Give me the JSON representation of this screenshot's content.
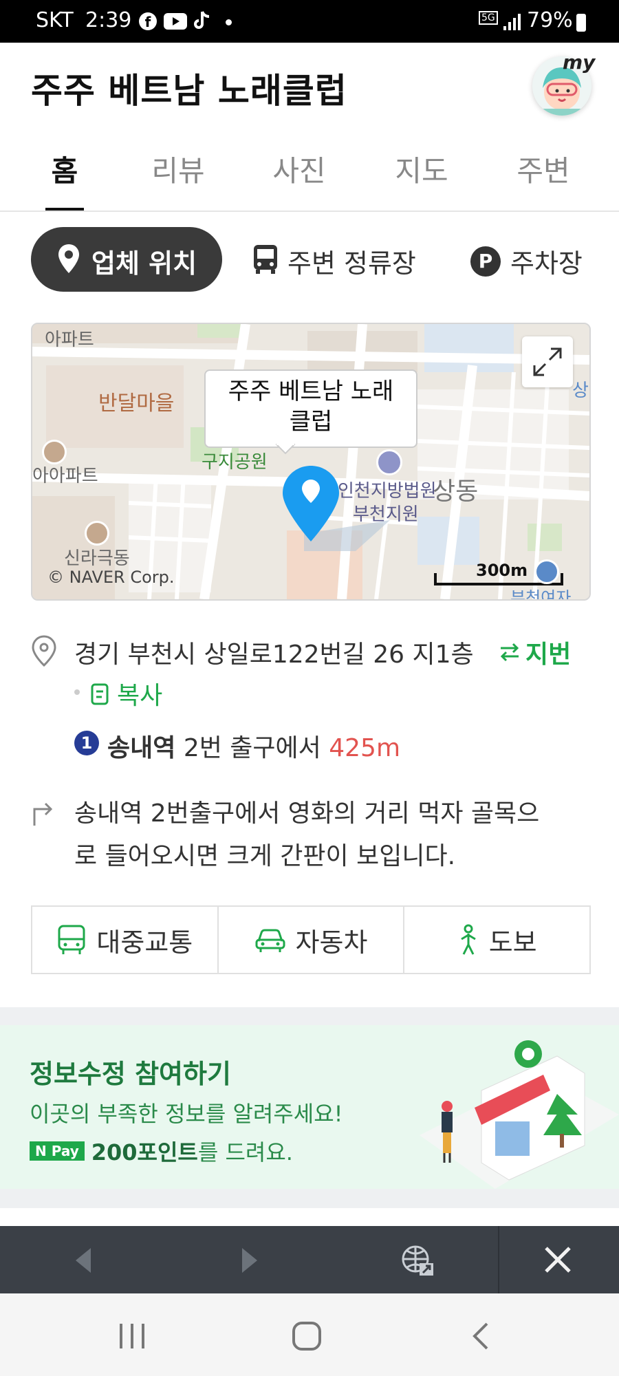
{
  "status_bar": {
    "carrier": "SKT",
    "time": "2:39",
    "network": "5G",
    "battery": "79%"
  },
  "header": {
    "title": "주주 베트남 노래클럽",
    "my_label": "my"
  },
  "tabs": [
    {
      "label": "홈",
      "active": true
    },
    {
      "label": "리뷰",
      "active": false
    },
    {
      "label": "사진",
      "active": false
    },
    {
      "label": "지도",
      "active": false
    },
    {
      "label": "주변",
      "active": false
    }
  ],
  "chips": {
    "location": "업체 위치",
    "bus_stop": "주변 정류장",
    "parking": "주차장",
    "parking_badge": "P"
  },
  "map": {
    "labels": {
      "apartment_top": "아파트",
      "bandal": "반달마을",
      "apartment_left": "아아파트",
      "guji_park": "구지공원",
      "court": "인천지방법원",
      "court_branch": "부천지원",
      "sangdong": "상동",
      "silla": "신라극동",
      "edge_right": "상",
      "bottom_right": "부천여자"
    },
    "marker_title": "주주 베트남 노래 클럽",
    "copyright": "© NAVER Corp.",
    "scale": "300m"
  },
  "address": {
    "text": "경기 부천시 상일로122번길 26 지1층",
    "jibun_label": "지번",
    "copy_label": "복사"
  },
  "subway": {
    "line": "1",
    "station": "송내역",
    "exit_text": "2번 출구에서",
    "distance": "425m"
  },
  "directions": {
    "line1": "송내역 2번출구에서 영화의 거리 먹자 골목으",
    "line2": "로 들어오시면 크게 간판이 보입니다."
  },
  "transport": {
    "public": "대중교통",
    "car": "자동차",
    "walk": "도보"
  },
  "banner": {
    "title": "정보수정 참여하기",
    "subtitle": "이곳의 부족한 정보를 알려주세요!",
    "npay": "N Pay",
    "points": "200포인트",
    "points_suffix": "를 드려요."
  },
  "colors": {
    "accent_green": "#1ea84a",
    "marker_blue": "#1a9cf0",
    "distance_red": "#e2534f",
    "subway_line1": "#263c96"
  }
}
